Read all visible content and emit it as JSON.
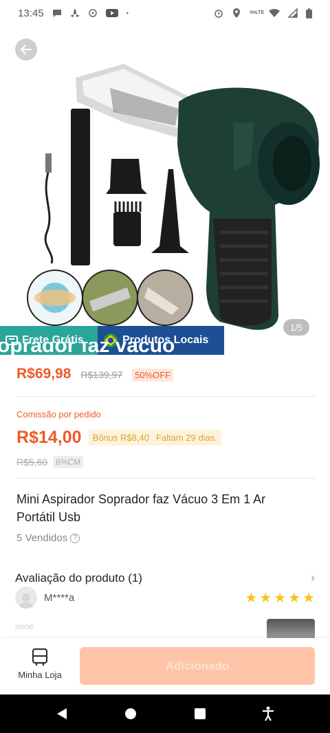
{
  "status_bar": {
    "time": "13:45",
    "network_badge": "VoLTE"
  },
  "hero": {
    "page_indicator": "1/5",
    "badges": {
      "frete": "Frete Grátis",
      "local": "Produtos Locais"
    },
    "ghost_title": "oprador faz vácuo"
  },
  "price": {
    "current": "R$69,98",
    "original": "R$139,97",
    "discount": "50%OFF"
  },
  "commission": {
    "label": "Comissão por pedido",
    "value": "R$14,00",
    "bonus": "Bônus R$8,40",
    "remaining": "Faltam 29 dias.",
    "old_value": "R$5,60",
    "rate": "8%CM"
  },
  "product": {
    "title": "Mini Aspirador Soprador faz Vácuo 3 Em 1 Ar Portátil Usb",
    "sold": "5 Vendidos"
  },
  "reviews": {
    "header": "Avaliação do produto (1)",
    "reviewer": "M****a",
    "rating": 5,
    "text": "none"
  },
  "actions": {
    "store_label": "Minha Loja",
    "add_label": "Adicionado"
  },
  "colors": {
    "accent": "#f05a28",
    "frete_badge": "#2aa59a",
    "local_badge": "#1d4f92",
    "star": "#f7c31b"
  }
}
